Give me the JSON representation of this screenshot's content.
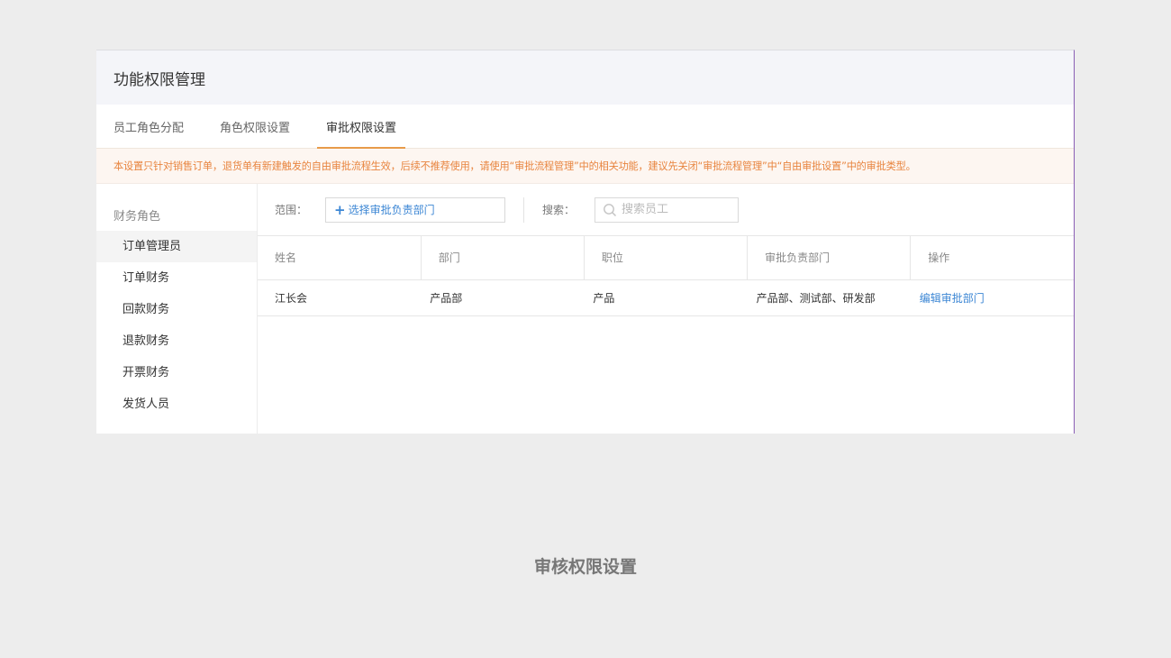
{
  "header": {
    "title": "功能权限管理"
  },
  "tabs": [
    {
      "label": "员工角色分配"
    },
    {
      "label": "角色权限设置"
    },
    {
      "label": "审批权限设置"
    }
  ],
  "notice": "本设置只针对销售订单，退货单有新建触发的自由审批流程生效，后续不推荐使用，请使用“审批流程管理”中的相关功能，建议先关闭“审批流程管理”中“自由审批设置”中的审批类型。",
  "sidebar": {
    "group_label": "财务角色",
    "items": [
      {
        "label": "订单管理员"
      },
      {
        "label": "订单财务"
      },
      {
        "label": "回款财务"
      },
      {
        "label": "退款财务"
      },
      {
        "label": "开票财务"
      },
      {
        "label": "发货人员"
      }
    ]
  },
  "filter": {
    "scope_label": "范围：",
    "scope_button": "选择审批负责部门",
    "search_label": "搜索：",
    "search_placeholder": "搜索员工"
  },
  "table": {
    "columns": [
      "姓名",
      "部门",
      "职位",
      "审批负责部门",
      "操作"
    ],
    "rows": [
      {
        "name": "江长会",
        "dept": "产品部",
        "position": "产品",
        "approval_depts": "产品部、测试部、研发部",
        "action": "编辑审批部门"
      }
    ]
  },
  "caption": "审核权限设置",
  "colors": {
    "accent": "#e89b4a",
    "link": "#3b86d4",
    "notice_text": "#e8843e"
  }
}
